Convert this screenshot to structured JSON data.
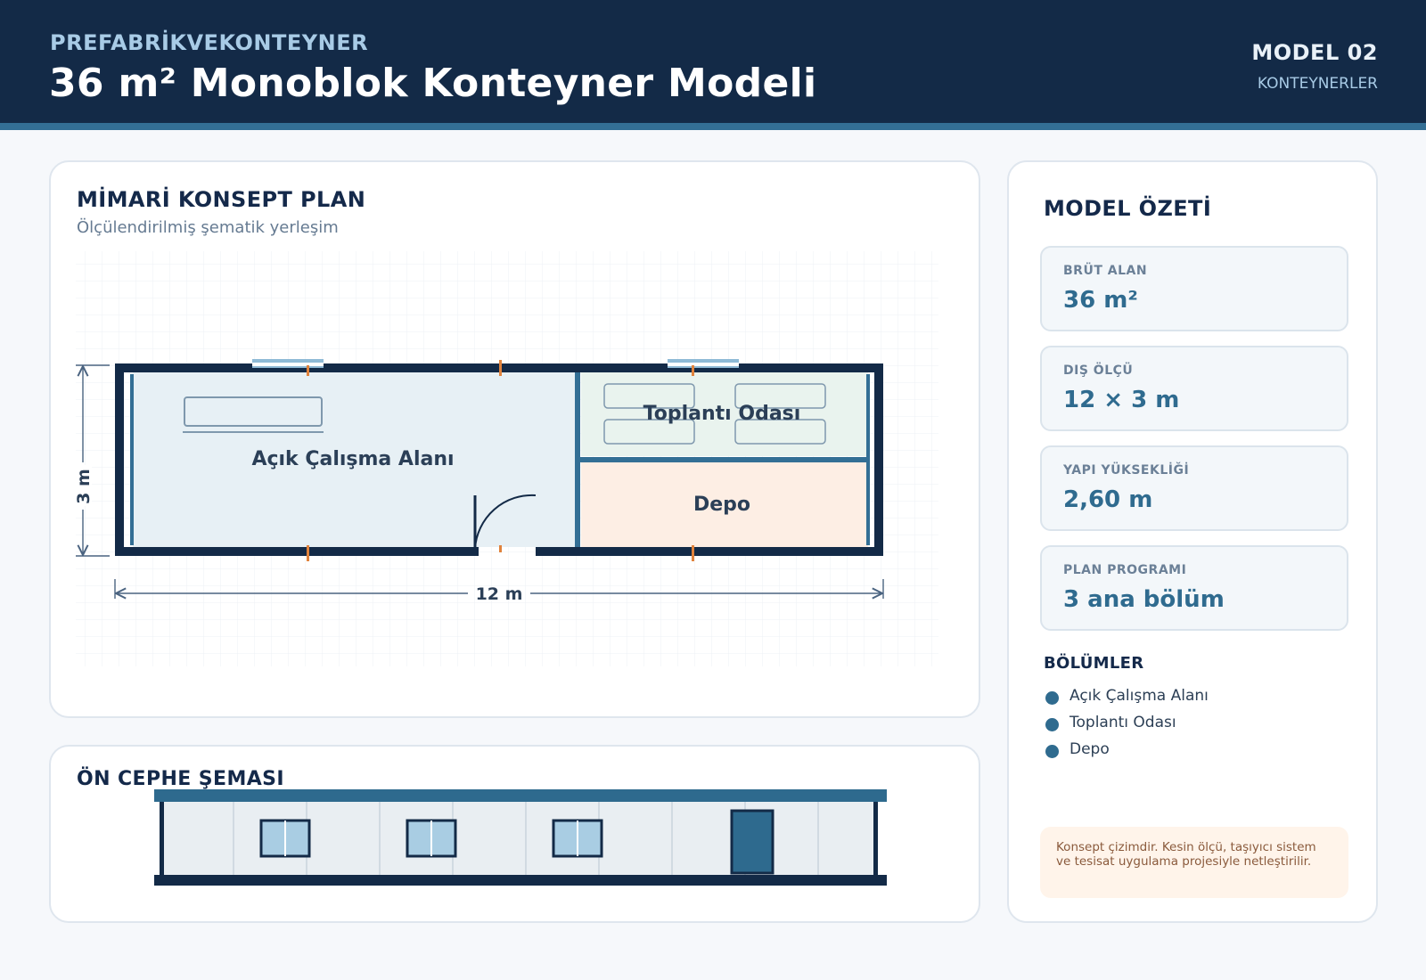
{
  "header": {
    "brand": "PREFABRİKVEKONTEYNER",
    "title": "36 m² Monoblok Konteyner Modeli",
    "model_no": "MODEL 02",
    "category": "KONTEYNERLER"
  },
  "plan": {
    "title": "MİMARİ KONSEPT PLAN",
    "subtitle": "Ölçülendirilmiş şematik yerleşim",
    "rooms": {
      "open_office": "Açık Çalışma Alanı",
      "meeting": "Toplantı Odası",
      "storage": "Depo"
    },
    "dim_width": "12 m",
    "dim_depth": "3 m"
  },
  "elevation": {
    "title": "ÖN CEPHE ŞEMASI"
  },
  "summary": {
    "title": "MODEL ÖZETİ",
    "stats": [
      {
        "label": "BRÜT ALAN",
        "value": "36 m²"
      },
      {
        "label": "DIŞ ÖLÇÜ",
        "value": "12 × 3 m"
      },
      {
        "label": "YAPI YÜKSEKLİĞİ",
        "value": "2,60 m"
      },
      {
        "label": "PLAN PROGRAMI",
        "value": "3 ana bölüm"
      }
    ],
    "sections_title": "BÖLÜMLER",
    "sections": [
      "Açık Çalışma Alanı",
      "Toplantı Odası",
      "Depo"
    ],
    "note": "Konsept çizimdir. Kesin ölçü, taşıyıcı sistem ve tesisat uygulama projesiyle netleştirilir."
  },
  "colors": {
    "navy": "#132a47",
    "accent": "#336f95",
    "open_office_fill": "#e7f0f5",
    "meeting_fill": "#e9f3ee",
    "storage_fill": "#fdeee4",
    "marker": "#e0823c"
  }
}
